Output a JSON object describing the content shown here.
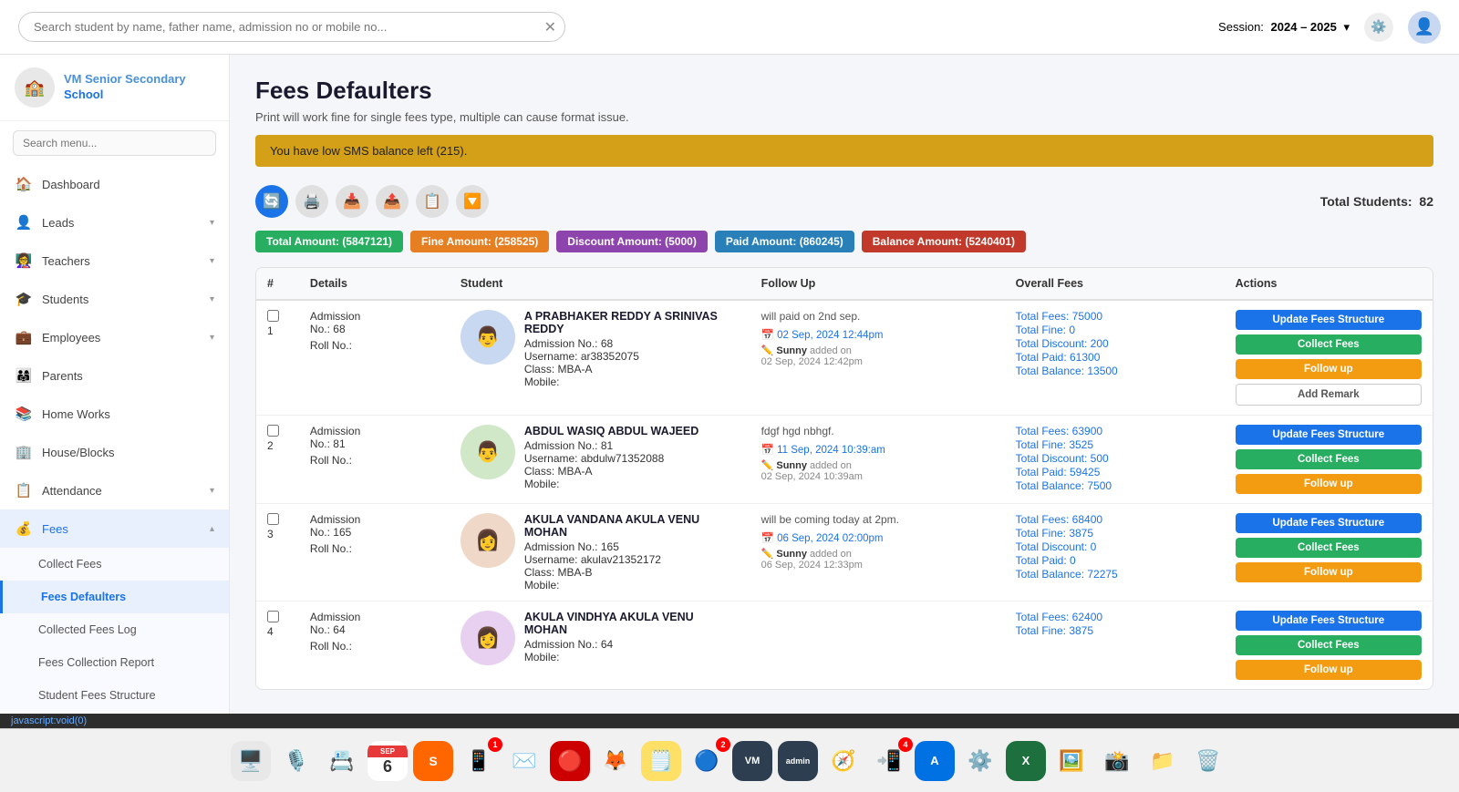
{
  "app": {
    "school_name": "VM Senior Secondary",
    "school_name2": "School"
  },
  "topbar": {
    "search_placeholder": "Search student by name, father name, admission no or mobile no...",
    "session_label": "Session:",
    "session_value": "2024 – 2025"
  },
  "sidebar": {
    "search_placeholder": "Search menu...",
    "items": [
      {
        "id": "dashboard",
        "label": "Dashboard",
        "icon": "🏠",
        "has_sub": false
      },
      {
        "id": "leads",
        "label": "Leads",
        "icon": "👤",
        "has_sub": true
      },
      {
        "id": "teachers",
        "label": "Teachers",
        "icon": "👩‍🏫",
        "has_sub": true
      },
      {
        "id": "students",
        "label": "Students",
        "icon": "🎓",
        "has_sub": true
      },
      {
        "id": "employees",
        "label": "Employees",
        "icon": "💼",
        "has_sub": true
      },
      {
        "id": "parents",
        "label": "Parents",
        "icon": "👨‍👩‍👧",
        "has_sub": false
      },
      {
        "id": "homeworks",
        "label": "Home Works",
        "icon": "📚",
        "has_sub": false
      },
      {
        "id": "houseblocks",
        "label": "House/Blocks",
        "icon": "🏢",
        "has_sub": false
      },
      {
        "id": "attendance",
        "label": "Attendance",
        "icon": "📋",
        "has_sub": true
      },
      {
        "id": "fees",
        "label": "Fees",
        "icon": "💰",
        "has_sub": true,
        "active": true
      }
    ],
    "sub_items": [
      {
        "id": "collect-fees",
        "label": "Collect Fees"
      },
      {
        "id": "fees-defaulters",
        "label": "Fees Defaulters",
        "active": true
      },
      {
        "id": "collected-fees-log",
        "label": "Collected Fees Log"
      },
      {
        "id": "fees-collection-report",
        "label": "Fees Collection Report"
      },
      {
        "id": "student-fees-structure",
        "label": "Student Fees Structure"
      }
    ]
  },
  "page": {
    "title": "Fees Defaulters",
    "subtitle": "Print will work fine for single fees type, multiple can cause format issue.",
    "alert": "You have low SMS balance left (215).",
    "total_students_label": "Total Students:",
    "total_students_value": "82"
  },
  "badges": [
    {
      "id": "total",
      "label": "Total Amount: (5847121)",
      "color": "badge-green"
    },
    {
      "id": "fine",
      "label": "Fine Amount: (258525)",
      "color": "badge-orange"
    },
    {
      "id": "discount",
      "label": "Discount Amount: (5000)",
      "color": "badge-purple"
    },
    {
      "id": "paid",
      "label": "Paid Amount: (860245)",
      "color": "badge-blue"
    },
    {
      "id": "balance",
      "label": "Balance Amount: (5240401)",
      "color": "badge-red"
    }
  ],
  "table": {
    "columns": [
      "#",
      "Details",
      "Student",
      "Follow Up",
      "Overall Fees",
      "Actions"
    ],
    "rows": [
      {
        "num": 1,
        "admission_no": "68",
        "roll_no": "",
        "student_name": "A PRABHAKER REDDY A SRINIVAS REDDY",
        "admission_label": "Admission No.: 68",
        "username": "ar38352075",
        "class": "MBA-A",
        "mobile": "",
        "followup_text": "will paid on 2nd sep.",
        "followup_date": "02 Sep, 2024 12:44pm",
        "added_by": "Sunny",
        "added_on": "02 Sep, 2024 12:42pm",
        "total_fees": "Total Fees: 75000",
        "total_fine": "Total Fine: 0",
        "total_discount": "Total Discount: 200",
        "total_paid": "Total Paid: 61300",
        "total_balance": "Total Balance: 13500"
      },
      {
        "num": 2,
        "admission_no": "81",
        "roll_no": "",
        "student_name": "ABDUL WASIQ ABDUL WAJEED",
        "admission_label": "Admission No.: 81",
        "username": "abdulw71352088",
        "class": "MBA-A",
        "mobile": "",
        "followup_text": "fdgf hgd nbhgf.",
        "followup_date": "11 Sep, 2024 10:39:am",
        "added_by": "Sunny",
        "added_on": "02 Sep, 2024 10:39am",
        "total_fees": "Total Fees: 63900",
        "total_fine": "Total Fine: 3525",
        "total_discount": "Total Discount: 500",
        "total_paid": "Total Paid: 59425",
        "total_balance": "Total Balance: 7500"
      },
      {
        "num": 3,
        "admission_no": "165",
        "roll_no": "",
        "student_name": "AKULA VANDANA AKULA VENU MOHAN",
        "admission_label": "Admission No.: 165",
        "username": "akulav21352172",
        "class": "MBA-B",
        "mobile": "",
        "followup_text": "will be coming today at 2pm.",
        "followup_date": "06 Sep, 2024 02:00pm",
        "added_by": "Sunny",
        "added_on": "06 Sep, 2024 12:33pm",
        "total_fees": "Total Fees: 68400",
        "total_fine": "Total Fine: 3875",
        "total_discount": "Total Discount: 0",
        "total_paid": "Total Paid: 0",
        "total_balance": "Total Balance: 72275"
      },
      {
        "num": 4,
        "admission_no": "64",
        "roll_no": "",
        "student_name": "AKULA VINDHYA AKULA VENU MOHAN",
        "admission_label": "Admission No.: 64",
        "username": "",
        "class": "",
        "mobile": "",
        "followup_text": "",
        "followup_date": "",
        "added_by": "",
        "added_on": "",
        "total_fees": "Total Fees: 62400",
        "total_fine": "Total Fine: 3875",
        "total_discount": "",
        "total_paid": "",
        "total_balance": ""
      }
    ]
  },
  "buttons": {
    "update": "Update Fees Structure",
    "collect": "Collect Fees",
    "followup": "Follow up",
    "remark": "Add Remark"
  },
  "dock": {
    "apps": [
      {
        "id": "finder",
        "icon": "🖥️",
        "badge": null
      },
      {
        "id": "siri",
        "icon": "🎙️",
        "badge": null
      },
      {
        "id": "contacts",
        "icon": "📇",
        "badge": null
      },
      {
        "id": "calendar",
        "icon": "cal",
        "badge": null,
        "date_top": "SEP",
        "date_bottom": "6"
      },
      {
        "id": "sublime",
        "icon": "🟠",
        "badge": null
      },
      {
        "id": "whatsapp",
        "icon": "📱",
        "badge": "1",
        "badge_color": "green"
      },
      {
        "id": "mail",
        "icon": "✉️",
        "badge": null
      },
      {
        "id": "op",
        "icon": "🔴",
        "badge": null
      },
      {
        "id": "firefox",
        "icon": "🦊",
        "badge": null
      },
      {
        "id": "notes",
        "icon": "🗒️",
        "badge": null
      },
      {
        "id": "chrome",
        "icon": "🔵",
        "badge": "2"
      },
      {
        "id": "vmemo",
        "icon": "📹",
        "badge": null
      },
      {
        "id": "vadmin",
        "icon": "⚙️",
        "badge": null
      },
      {
        "id": "safari",
        "icon": "🧭",
        "badge": null
      },
      {
        "id": "facetime",
        "icon": "📲",
        "badge": "4"
      },
      {
        "id": "appstore",
        "icon": "🅰️",
        "badge": null
      },
      {
        "id": "settings",
        "icon": "⚙️",
        "badge": null
      },
      {
        "id": "excel",
        "icon": "📊",
        "badge": null
      },
      {
        "id": "preview",
        "icon": "🖼️",
        "badge": null
      },
      {
        "id": "capture",
        "icon": "📸",
        "badge": null
      },
      {
        "id": "files",
        "icon": "📁",
        "badge": null
      },
      {
        "id": "trash",
        "icon": "🗑️",
        "badge": null
      }
    ]
  },
  "status_bar": {
    "text": "javascript:void(0)"
  }
}
